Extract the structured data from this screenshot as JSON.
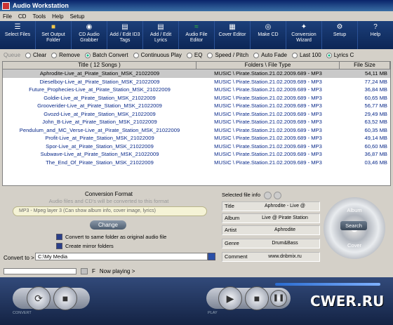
{
  "window": {
    "title": "Audio Workstation"
  },
  "menu": [
    "File",
    "CD",
    "Tools",
    "Help",
    "Setup"
  ],
  "toolbar": [
    {
      "label": "Select Files",
      "icon": "select-files-icon"
    },
    {
      "label": "Set Output Folder",
      "icon": "folder-icon"
    },
    {
      "label": "CD Audio Grabber",
      "icon": "cd-icon"
    },
    {
      "label": "Add / Edit ID3 Tags",
      "icon": "tag-icon"
    },
    {
      "label": "Add / Edit Lyrics",
      "icon": "lyrics-icon"
    },
    {
      "label": "Audio File Editor",
      "icon": "wave-icon"
    },
    {
      "label": "Cover Editor",
      "icon": "cover-icon"
    },
    {
      "label": "Make CD",
      "icon": "burn-icon"
    },
    {
      "label": "Conversion Wizard",
      "icon": "wizard-icon"
    },
    {
      "label": "Setup",
      "icon": "gear-icon"
    },
    {
      "label": "Help",
      "icon": "help-icon"
    }
  ],
  "options": {
    "queue": "Queue",
    "clear": "Clear",
    "remove": "Remove",
    "batch_convert": "Batch Convert",
    "continuous_play": "Continuous Play",
    "eq": "EQ",
    "speed_pitch": "Speed / Pitch",
    "auto_fade": "Auto Fade",
    "last100": "Last 100",
    "lyrics": "Lyrics C"
  },
  "table": {
    "headers": [
      "Title    ( 12 Songs )",
      "Folders \\ File Type",
      "File Size"
    ],
    "rows": [
      [
        "Aphrodite-Live_at_Pirate_Station_MSK_21022009",
        "MUSIC \\ Pirate.Station.21.02.2009.689 - MP3",
        "54,11 MB"
      ],
      [
        "Dieselboy-Live_at_Pirate_Station_MSK_21022009",
        "MUSIC \\ Pirate.Station.21.02.2009.689 - MP3",
        "77,24 MB"
      ],
      [
        "Future_Prophecies-Live_at_Pirate_Station_MSK_21022009",
        "MUSIC \\ Pirate.Station.21.02.2009.689 - MP3",
        "36,84 MB"
      ],
      [
        "Goldie-Live_at_Pirate_Station_MSK_21022009",
        "MUSIC \\ Pirate.Station.21.02.2009.689 - MP3",
        "60,65 MB"
      ],
      [
        "Grooverider-Live_at_Pirate_Station_MSK_21022009",
        "MUSIC \\ Pirate.Station.21.02.2009.689 - MP3",
        "56,77 MB"
      ],
      [
        "Gvozd-Live_at_Pirate_Station_MSK_21022009",
        "MUSIC \\ Pirate.Station.21.02.2009.689 - MP3",
        "29,49 MB"
      ],
      [
        "John_B-Live_at_Pirate_Station_MSK_21022009",
        "MUSIC \\ Pirate.Station.21.02.2009.689 - MP3",
        "63,52 MB"
      ],
      [
        "Pendulum_and_MC_Verse-Live_at_Pirate_Station_MSK_21022009",
        "MUSIC \\ Pirate.Station.21.02.2009.689 - MP3",
        "60,35 MB"
      ],
      [
        "Profit-Live_at_Pirate_Station_MSK_21022009",
        "MUSIC \\ Pirate.Station.21.02.2009.689 - MP3",
        "49,14 MB"
      ],
      [
        "Spor-Live_at_Pirate_Station_MSK_21022009",
        "MUSIC \\ Pirate.Station.21.02.2009.689 - MP3",
        "60,60 MB"
      ],
      [
        "Subwave-Live_at_Pirate_Station_MSK_21022009",
        "MUSIC \\ Pirate.Station.21.02.2009.689 - MP3",
        "36,87 MB"
      ],
      [
        "The_End_Of_Pirate_Station_MSK_21022009",
        "MUSIC \\ Pirate.Station.21.02.2009.689 - MP3",
        "03,46 MB"
      ]
    ]
  },
  "conversion": {
    "title": "Conversion Format",
    "subtitle": "Audio files and CD's will be converted to this format",
    "format": "MP3 - Mpeg layer 3 (Can show album info, cover image, lyrics)",
    "change": "Change",
    "same_folder": "Convert to same folder as original audio file",
    "mirror": "Create mirror folders",
    "convert_to_label": "Convert to >",
    "convert_to_value": "C:\\My Media"
  },
  "fileinfo": {
    "title": "Selected file info",
    "fields": [
      {
        "key": "Title",
        "value": "Aphrodite - Live @"
      },
      {
        "key": "Album",
        "value": "Live @ Pirate Station"
      },
      {
        "key": "Artist",
        "value": "Aphrodite"
      },
      {
        "key": "Genre",
        "value": "Drum&Bass"
      },
      {
        "key": "Comment",
        "value": "www.dnbmix.ru"
      }
    ]
  },
  "disc": {
    "album": "Album",
    "search": "Search",
    "cover": "Cover"
  },
  "nowplaying": {
    "f": "F",
    "label": "Now playing >"
  },
  "player": {
    "convert": "CONVERT",
    "play": "PLAY",
    "watermark": "CWER.RU"
  }
}
